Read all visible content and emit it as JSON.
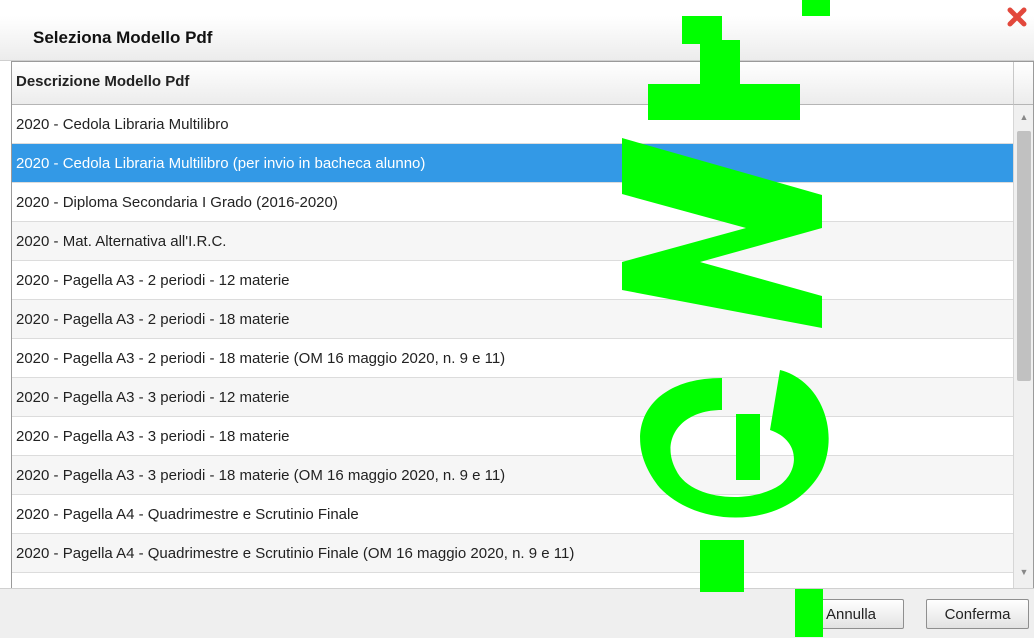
{
  "dialog": {
    "title": "Seleziona Modello Pdf",
    "close_icon": "close-x-icon"
  },
  "table": {
    "header": "Descrizione Modello Pdf",
    "rows": [
      "2020 - Cedola Libraria Multilibro",
      "2020 - Cedola Libraria Multilibro (per invio in bacheca alunno)",
      "2020 - Diploma Secondaria I Grado (2016-2020)",
      "2020 - Mat. Alternativa all'I.R.C.",
      "2020 - Pagella A3 - 2 periodi - 12 materie",
      "2020 - Pagella A3 - 2 periodi - 18 materie",
      "2020 - Pagella A3 - 2 periodi - 18 materie (OM 16 maggio 2020, n. 9 e 11)",
      "2020 - Pagella A3 - 3 periodi - 12 materie",
      "2020 - Pagella A3 - 3 periodi - 18 materie",
      "2020 - Pagella A3 - 3 periodi - 18 materie (OM 16 maggio 2020, n. 9 e 11)",
      "2020 - Pagella A4 - Quadrimestre e Scrutinio Finale",
      "2020 - Pagella A4 - Quadrimestre e Scrutinio Finale (OM 16 maggio 2020, n. 9 e 11)"
    ],
    "selected_index": 1
  },
  "footer": {
    "cancel_label": "Annulla",
    "confirm_label": "Conferma"
  },
  "colors": {
    "selection": "#3399e6",
    "close": "#e2483c",
    "watermark": "#00ff00"
  }
}
